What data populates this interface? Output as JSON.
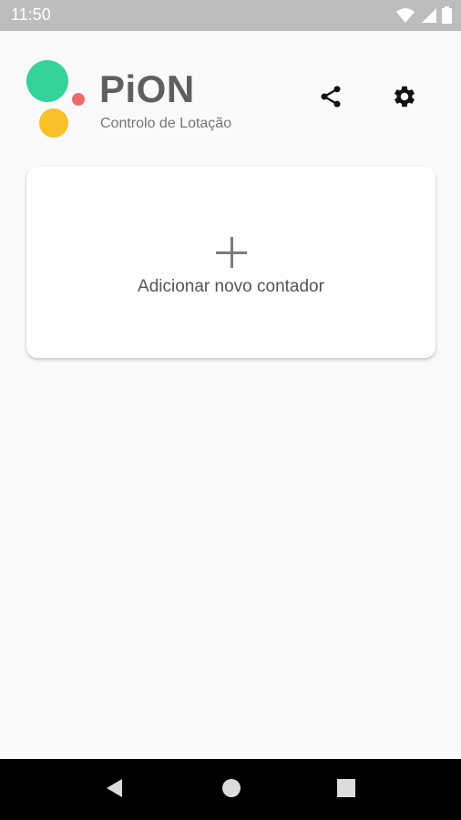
{
  "status_bar": {
    "time": "11:50",
    "icons": [
      "wifi-icon",
      "signal-icon",
      "battery-icon"
    ]
  },
  "header": {
    "title": "PiON",
    "subtitle": "Controlo de Lotação",
    "actions": [
      "share-icon",
      "settings-icon"
    ]
  },
  "logo": {
    "colors": {
      "green": "#34d39a",
      "red": "#ef6b6b",
      "yellow": "#f8c12a"
    }
  },
  "card": {
    "icon": "plus-icon",
    "label": "Adicionar novo contador"
  },
  "nav_bar": {
    "buttons": [
      "back-icon",
      "home-icon",
      "recents-icon"
    ]
  },
  "colors": {
    "status_bar": "#bdbdbd",
    "background": "#fafafa",
    "title": "#5f5f5f",
    "nav_bar": "#000000"
  }
}
